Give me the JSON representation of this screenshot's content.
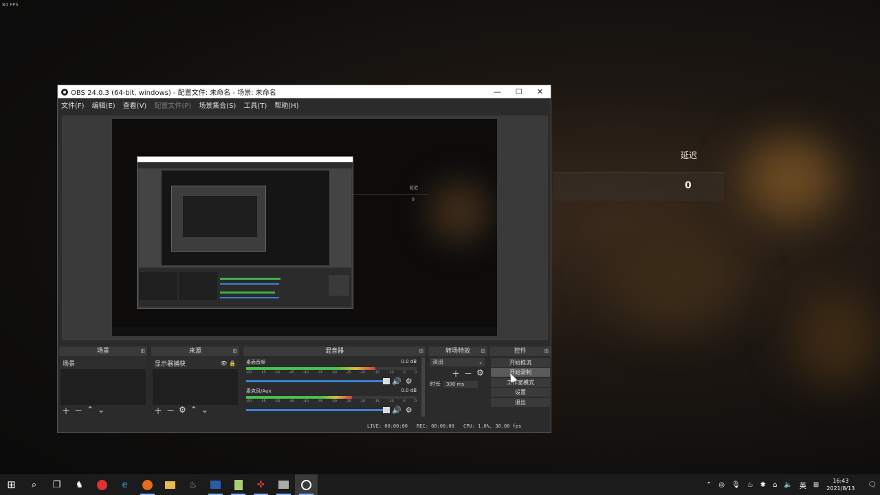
{
  "overlay": {
    "fps": "84 FPS"
  },
  "background": {
    "latency_label": "延迟",
    "latency_value": "0"
  },
  "window": {
    "title": "OBS 24.0.3 (64-bit, windows) - 配置文件: 未命名 - 场景: 未命名",
    "controls": {
      "minimize": "—",
      "maximize": "☐",
      "close": "✕"
    },
    "menu": [
      {
        "label": "文件(F)",
        "disabled": false
      },
      {
        "label": "编辑(E)",
        "disabled": false
      },
      {
        "label": "查看(V)",
        "disabled": false
      },
      {
        "label": "配置文件(P)",
        "disabled": true
      },
      {
        "label": "场景集合(S)",
        "disabled": false
      },
      {
        "label": "工具(T)",
        "disabled": false
      },
      {
        "label": "帮助(H)",
        "disabled": false
      }
    ]
  },
  "nested_preview": {
    "latency_label": "延迟",
    "latency_value": "0"
  },
  "docks": {
    "scenes": {
      "title": "场景",
      "items": [
        "场景"
      ]
    },
    "sources": {
      "title": "来源",
      "items": [
        "显示器捕获"
      ]
    },
    "mixer": {
      "title": "混音器",
      "channels": [
        {
          "name": "桌面音频",
          "db": "0.0 dB",
          "level": 0.76
        },
        {
          "name": "麦克风/Aux",
          "db": "0.0 dB",
          "level": 0.62
        }
      ],
      "ticks": [
        "-60",
        "-55",
        "-50",
        "-45",
        "-40",
        "-35",
        "-30",
        "-25",
        "-20",
        "-15",
        "-10",
        "-5",
        "0"
      ]
    },
    "transitions": {
      "title": "转场特效",
      "selected": "淡出",
      "duration_label": "时长",
      "duration_value": "300 ms"
    },
    "controls": {
      "title": "控件",
      "buttons": [
        "开始推流",
        "开始录制",
        "工作室模式",
        "设置",
        "退出"
      ]
    }
  },
  "status": {
    "live": "LIVE: 00:00:00",
    "rec": "REC: 00:00:00",
    "cpu": "CPU: 1.0%, 30.00 fps"
  },
  "taskbar": {
    "apps": [
      "windows-start",
      "search",
      "task-view",
      "app-wolf",
      "netease-music",
      "edge",
      "firefox",
      "file-explorer",
      "steam",
      "powershell",
      "notepad",
      "app-red",
      "app-gray",
      "obs"
    ],
    "tray": {
      "ime": "英",
      "time": "16:43",
      "date": "2021/8/13"
    }
  }
}
